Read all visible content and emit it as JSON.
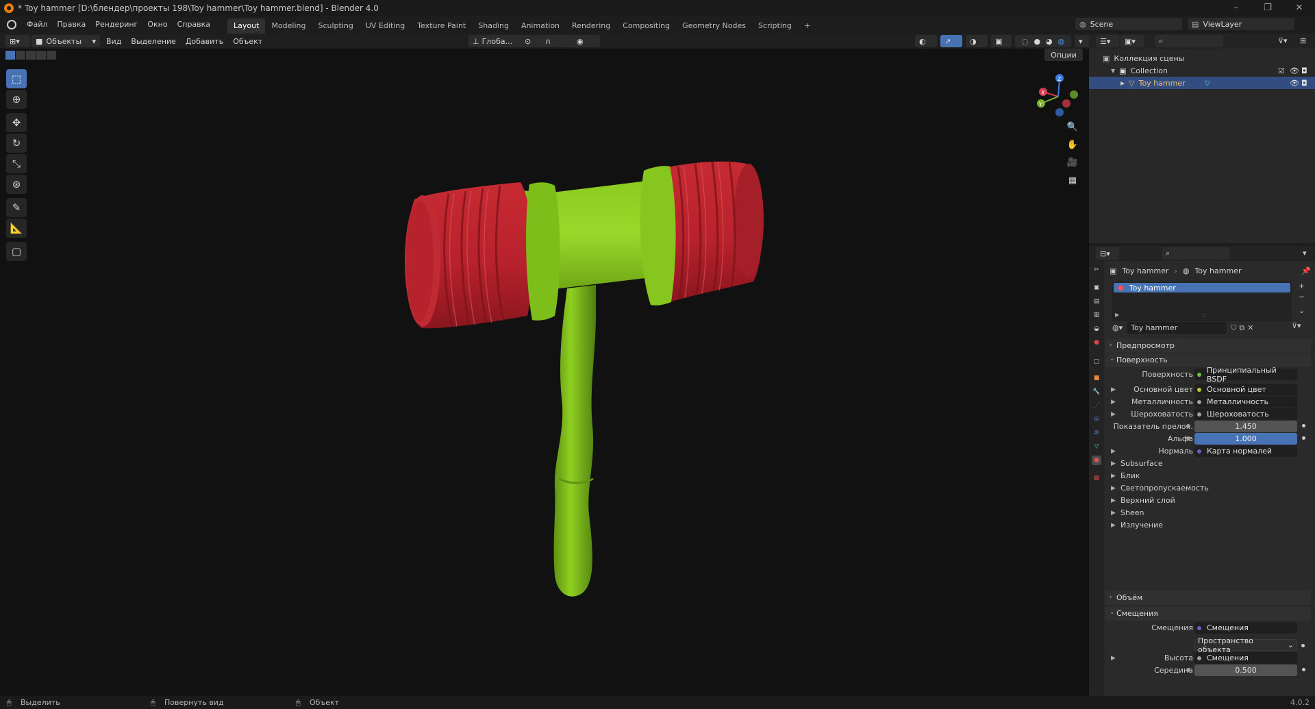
{
  "titlebar": {
    "title": "* Toy hammer [D:\\блендер\\проекты 198\\Toy hammer\\Toy hammer.blend] - Blender 4.0",
    "controls": [
      "–",
      "❐",
      "✕"
    ]
  },
  "menu": [
    "Файл",
    "Правка",
    "Рендеринг",
    "Окно",
    "Справка"
  ],
  "workspaces": [
    "Layout",
    "Modeling",
    "Sculpting",
    "UV Editing",
    "Texture Paint",
    "Shading",
    "Animation",
    "Rendering",
    "Compositing",
    "Geometry Nodes",
    "Scripting"
  ],
  "active_workspace": "Layout",
  "add_workspace": "+",
  "scene": {
    "label": "Scene",
    "view_layer": "ViewLayer"
  },
  "viewport_header": {
    "mode": "Объекты",
    "menus": [
      "Вид",
      "Выделение",
      "Добавить",
      "Объект"
    ],
    "orientation": "Глоба...",
    "options": "Опции"
  },
  "outliner": {
    "root": "Коллекция сцены",
    "collection": "Collection",
    "object": "Toy hammer"
  },
  "properties": {
    "breadcrumb": [
      "Toy hammer",
      "Toy hammer"
    ],
    "slot": "Toy hammer",
    "material_name": "Toy hammer",
    "sections": {
      "preview": "Предпросмотр",
      "surface": "Поверхность",
      "volume": "Объём",
      "displacement": "Смещения"
    },
    "rows": [
      {
        "label": "Поверхность",
        "value": "Принципиальный BSDF",
        "kind": "link",
        "dot": "#6fbf3a"
      },
      {
        "label": "Основной цвет",
        "value": "Основной цвет",
        "kind": "link",
        "dot": "#c7c729",
        "arrow": true
      },
      {
        "label": "Металличность",
        "value": "Металличность",
        "kind": "link",
        "dot": "#a1a1a1",
        "arrow": true
      },
      {
        "label": "Шероховатость",
        "value": "Шероховатость",
        "kind": "link",
        "dot": "#a1a1a1",
        "arrow": true
      },
      {
        "label": "Показатель прело...",
        "value": "1.450",
        "kind": "num",
        "dot": "#a1a1a1"
      },
      {
        "label": "Альфа",
        "value": "1.000",
        "kind": "blue",
        "dot": "#a1a1a1"
      },
      {
        "label": "Нормаль",
        "value": "Карта нормалей",
        "kind": "link",
        "dot": "#6363c7",
        "arrow": true
      }
    ],
    "subpanels": [
      "Subsurface",
      "Блик",
      "Светопропускаемость",
      "Верхний слой",
      "Sheen",
      "Излучение"
    ],
    "displacement_rows": [
      {
        "label": "Смещения",
        "value": "Смещения",
        "kind": "link",
        "dot": "#6363c7"
      },
      {
        "label": "",
        "value": "Пространство объекта",
        "kind": "dropdown"
      },
      {
        "label": "Высота",
        "value": "Смещения",
        "kind": "link",
        "dot": "#a1a1a1",
        "arrow": true
      },
      {
        "label": "Середина",
        "value": "0.500",
        "kind": "num",
        "dot": "#a1a1a1"
      }
    ]
  },
  "statusbar": {
    "items": [
      "Выделить",
      "Повернуть вид",
      "Объект"
    ],
    "version": "4.0.2"
  },
  "colors": {
    "accent": "#4772b3",
    "hammer_head": "#b0202a",
    "hammer_body": "#7ec21a",
    "viewport_bg": "#111111"
  }
}
